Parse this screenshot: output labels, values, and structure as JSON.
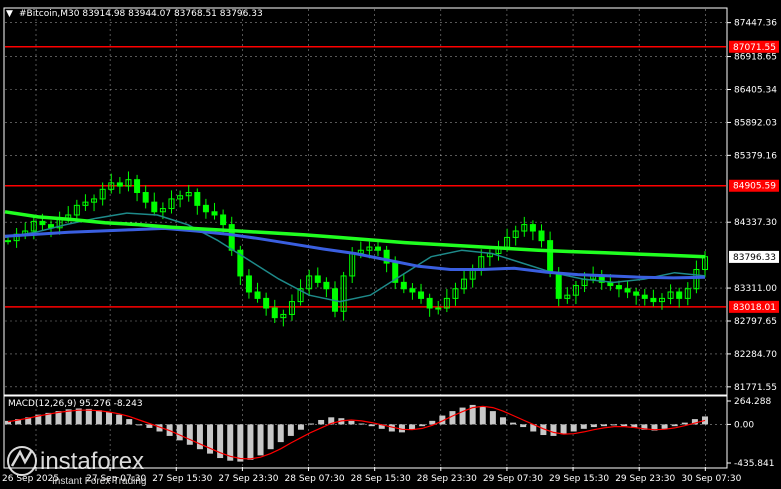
{
  "header": {
    "arrow": "▼",
    "title": "#Bitcoin,M30  83914.98 83944.07 83768.51 83796.33"
  },
  "macd_header": "MACD(12,26,9) 95.276 -8.243",
  "watermark": {
    "brand": "instaforex",
    "tagline": "Instant Forex Trading"
  },
  "colors": {
    "background": "#000000",
    "candle": "#00ff00",
    "ma_green": "#20ff20",
    "ma_blue": "#3a5fe0",
    "ma_teal": "#1e8a8a",
    "level_line": "#ff0000",
    "macd_hist": "#c8c8c8",
    "macd_signal": "#ff0000",
    "grid": "#ffffff"
  },
  "chart_data": {
    "type": "line",
    "symbol": "#Bitcoin",
    "timeframe": "M30",
    "ohlc_header": {
      "open": 83914.98,
      "high": 83944.07,
      "low": 83768.51,
      "close": 83796.33
    },
    "x_tick_labels": [
      "26 Sep 2025",
      "27 Sep 07:30",
      "27 Sep 15:30",
      "27 Sep 23:30",
      "28 Sep 07:30",
      "28 Sep 15:30",
      "28 Sep 23:30",
      "29 Sep 07:30",
      "29 Sep 15:30",
      "29 Sep 23:30",
      "30 Sep 07:30"
    ],
    "y_tick_labels": [
      "87447.36",
      "86918.65",
      "86405.34",
      "85892.03",
      "85379.16",
      "84337.30",
      "83311.00",
      "82797.65",
      "82284.70",
      "81771.55"
    ],
    "ylim": [
      81660,
      87660
    ],
    "grid": true,
    "levels": [
      {
        "label": "87071.55",
        "value": 87071.55
      },
      {
        "label": "84905.59",
        "value": 84905.59
      },
      {
        "label": "83018.01",
        "value": 83018.01
      }
    ],
    "current_price_label": "83796.33",
    "current_price": 83796.33,
    "price_series": [
      84050,
      84150,
      84200,
      84350,
      84300,
      84250,
      84400,
      84450,
      84600,
      84650,
      84700,
      84850,
      84950,
      84900,
      85000,
      84800,
      84650,
      84500,
      84550,
      84700,
      84750,
      84800,
      84600,
      84500,
      84450,
      84300,
      83900,
      83500,
      83250,
      83150,
      83000,
      82850,
      82900,
      83100,
      83300,
      83500,
      83400,
      83300,
      82950,
      83500,
      83850,
      83900,
      83950,
      83900,
      83700,
      83400,
      83300,
      83250,
      83150,
      83000,
      83000,
      83150,
      83300,
      83450,
      83600,
      83800,
      83850,
      83950,
      84100,
      84200,
      84300,
      84200,
      84050,
      83550,
      83150,
      83200,
      83350,
      83450,
      83500,
      83400,
      83350,
      83300,
      83250,
      83200,
      83150,
      83100,
      83150,
      83250,
      83150,
      83300,
      83600,
      83800
    ],
    "ma_green": [
      84500,
      84420,
      84380,
      84330,
      84300,
      84260,
      84230,
      84200,
      84170,
      84140,
      84100,
      84060,
      84020,
      83990,
      83960,
      83930,
      83900,
      83880,
      83860,
      83840,
      83820,
      83800
    ],
    "ma_blue": [
      84120,
      84150,
      84180,
      84200,
      84220,
      84240,
      84200,
      84150,
      84080,
      84000,
      83920,
      83850,
      83750,
      83650,
      83600,
      83600,
      83620,
      83560,
      83520,
      83500,
      83480,
      83470,
      83480
    ],
    "ma_teal": [
      84100,
      84180,
      84300,
      84400,
      84480,
      84450,
      84300,
      84050,
      83750,
      83450,
      83200,
      83100,
      83200,
      83500,
      83800,
      83900,
      83850,
      83700,
      83550,
      83450,
      83400,
      83450,
      83550,
      83500
    ],
    "macd": {
      "y_tick_labels": [
        "264.288",
        "0.00",
        "-435.841"
      ],
      "ylim": [
        -435.841,
        264.288
      ],
      "histogram": [
        40,
        60,
        80,
        110,
        130,
        150,
        170,
        180,
        175,
        160,
        140,
        110,
        60,
        0,
        -40,
        -80,
        -130,
        -180,
        -230,
        -280,
        -330,
        -380,
        -410,
        -420,
        -400,
        -350,
        -280,
        -200,
        -130,
        -60,
        10,
        50,
        80,
        70,
        40,
        10,
        -20,
        -50,
        -80,
        -90,
        -60,
        -20,
        40,
        100,
        150,
        190,
        220,
        200,
        150,
        80,
        20,
        -30,
        -80,
        -120,
        -130,
        -110,
        -80,
        -50,
        -30,
        -20,
        -10,
        -20,
        -40,
        -60,
        -70,
        -50,
        -20,
        20,
        60,
        90
      ],
      "signal": [
        30,
        50,
        70,
        95,
        115,
        135,
        150,
        160,
        160,
        155,
        140,
        120,
        90,
        50,
        10,
        -30,
        -70,
        -120,
        -170,
        -220,
        -270,
        -320,
        -360,
        -385,
        -390,
        -370,
        -330,
        -275,
        -210,
        -150,
        -90,
        -40,
        10,
        40,
        50,
        40,
        20,
        -5,
        -30,
        -55,
        -60,
        -45,
        -10,
        40,
        95,
        145,
        190,
        205,
        190,
        150,
        100,
        50,
        0,
        -50,
        -90,
        -110,
        -105,
        -85,
        -60,
        -40,
        -25,
        -25,
        -35,
        -50,
        -60,
        -55,
        -40,
        -15,
        15,
        45
      ]
    }
  }
}
